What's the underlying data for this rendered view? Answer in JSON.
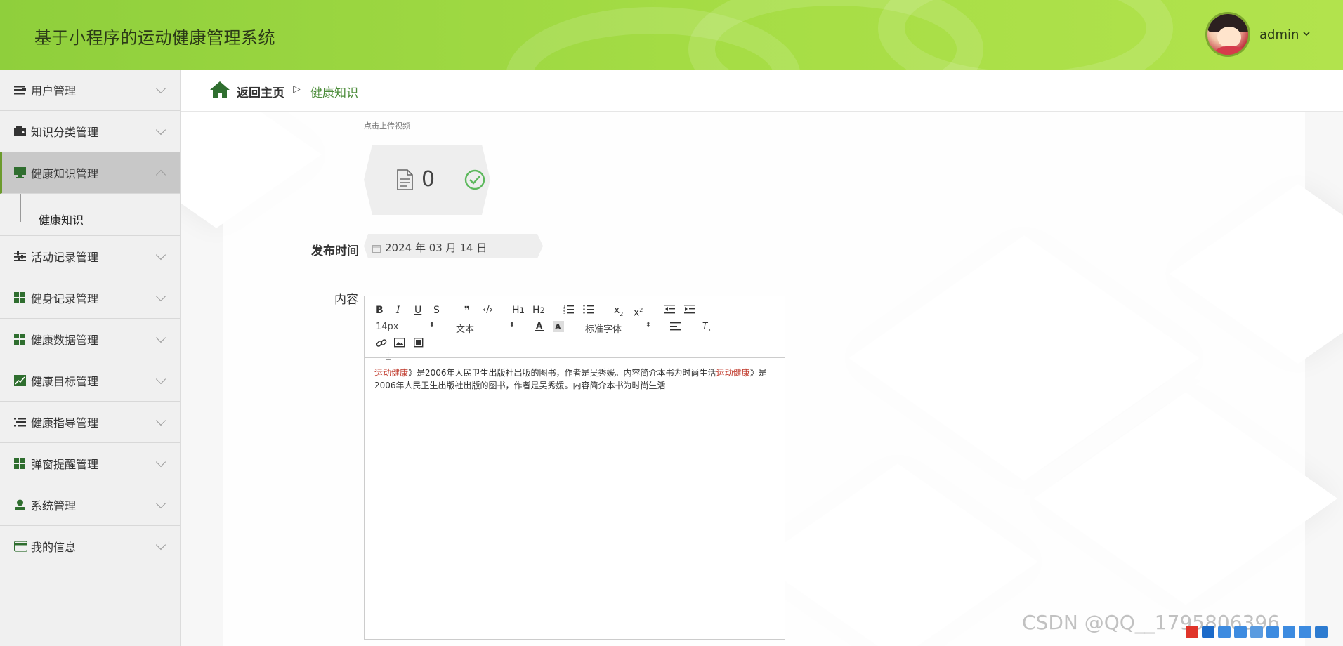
{
  "header": {
    "title": "基于小程序的运动健康管理系统",
    "user_name": "admin",
    "user_caret": "⌄"
  },
  "sidebar": {
    "items": [
      {
        "label": "用户管理",
        "icon": "list-icon"
      },
      {
        "label": "知识分类管理",
        "icon": "wallet-icon"
      },
      {
        "label": "健康知识管理",
        "icon": "monitor-icon",
        "active": true
      },
      {
        "label": "活动记录管理",
        "icon": "sliders-icon"
      },
      {
        "label": "健身记录管理",
        "icon": "grid-icon"
      },
      {
        "label": "健康数据管理",
        "icon": "grid-icon"
      },
      {
        "label": "健康目标管理",
        "icon": "chart-icon"
      },
      {
        "label": "健康指导管理",
        "icon": "list-icon"
      },
      {
        "label": "弹窗提醒管理",
        "icon": "grid-icon"
      },
      {
        "label": "系统管理",
        "icon": "user-icon"
      },
      {
        "label": "我的信息",
        "icon": "card-icon"
      }
    ],
    "submenu_label": "健康知识"
  },
  "breadcrumb": {
    "home": "返回主页",
    "separator": "▷",
    "current": "健康知识"
  },
  "form": {
    "upload_hint": "点击上传视频",
    "file_count": "0",
    "date_label": "发布时间",
    "date_value": "2024 年 03 月 14 日",
    "content_label": "内容"
  },
  "editor": {
    "font_size": "14px",
    "block_type": "文本",
    "font_family": "标准字体",
    "body_red_1": "运动健康",
    "body_text_1": "》是2006年人民卫生出版社出版的图书，作者是吴秀媛。内容简介本书为时尚生活",
    "body_red_2": "运动健康",
    "body_text_2": "》是2006年人民卫生出版社出版的图书，作者是吴秀媛。内容简介本书为时尚生活"
  },
  "watermark": "CSDN @QQ__1795806396",
  "colors": {
    "header_green": "#a6dd45",
    "accent_green": "#4c8c3a",
    "red_text": "#c0392b"
  }
}
